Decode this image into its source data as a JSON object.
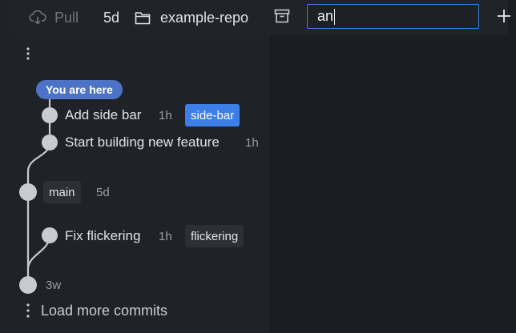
{
  "toolbar": {
    "pull_label": "Pull",
    "pull_icon": "cloud-download-icon",
    "age": "5d",
    "repo_icon": "folder-icon",
    "repo_name": "example-repo",
    "archive_icon": "archive-icon",
    "search_value": "an",
    "add_icon": "plus-icon"
  },
  "graph": {
    "you_are_here": "You are here",
    "commits": [
      {
        "message": "Add side bar",
        "time": "1h",
        "branch": "side-bar",
        "current": true
      },
      {
        "message": "Start building new feature",
        "time": "1h"
      },
      {
        "branch": "main",
        "time": "5d"
      },
      {
        "message": "Fix flickering",
        "time": "1h",
        "branch": "flickering"
      },
      {
        "time": "3w"
      }
    ],
    "load_more": "Load more commits"
  },
  "colors": {
    "accent": "#3d7fe8",
    "you_are_here_bg": "#4d73c7",
    "node": "#c8ccd1",
    "line": "#c8ccd1"
  }
}
